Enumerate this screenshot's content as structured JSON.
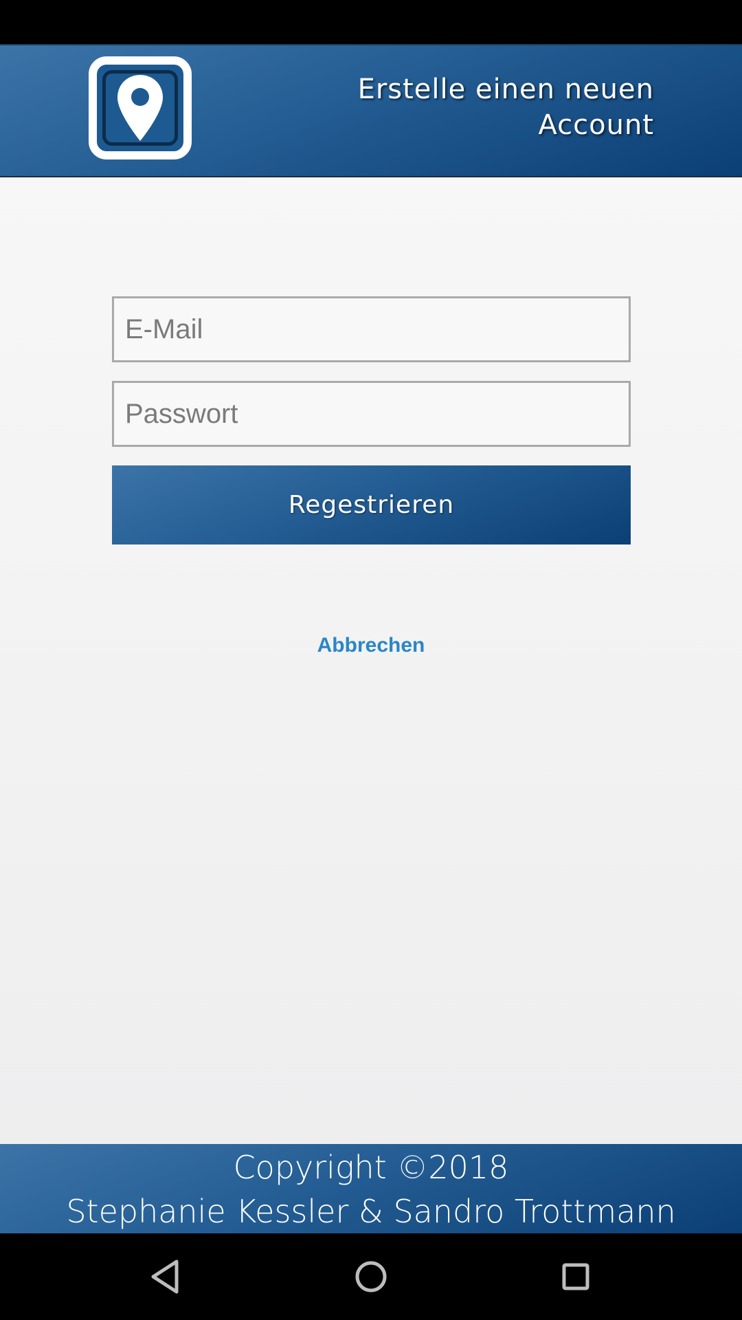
{
  "header": {
    "logo_icon": "map-pin-icon",
    "title": "Erstelle einen neuen Account"
  },
  "form": {
    "email_placeholder": "E-Mail",
    "email_value": "",
    "password_placeholder": "Passwort",
    "password_value": "",
    "register_label": "Regestrieren",
    "cancel_label": "Abbrechen"
  },
  "footer": {
    "copyright": "Copyright ©2018",
    "authors": "Stephanie Kessler & Sandro Trottmann"
  },
  "navbar": {
    "back_icon": "back-triangle-icon",
    "home_icon": "home-circle-icon",
    "recent_icon": "recent-apps-square-icon"
  },
  "colors": {
    "brand_blue": "#245d93",
    "brand_blue_dark": "#0b3f75",
    "link_blue": "#2b86c5",
    "background": "#f2f2f2"
  }
}
